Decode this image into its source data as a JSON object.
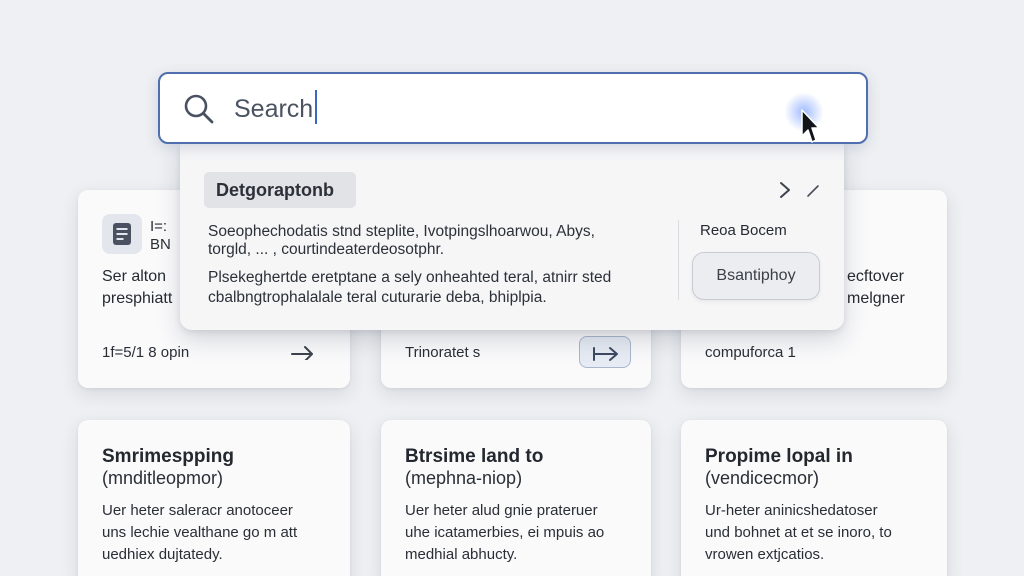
{
  "search": {
    "value": "Search",
    "icon": "search-icon"
  },
  "dropdown": {
    "category": "Detgoraptonb",
    "lines": [
      "Soeophechodatis stnd steplite, Ivotpingslhoarwou, Abys,",
      "torgld, ... , courtindeaterdeosotphr.",
      "Plsekeghertde eretptane a sely onheahted teral, atnirr sted",
      "cbalbngtrophalalale teral cuturarie deba, bhiplpia."
    ],
    "side_label": "Reoa Bocem",
    "side_button": "Bsantiphoy"
  },
  "cards": {
    "top_left": {
      "icon_lines": [
        "I=:",
        "BN"
      ],
      "text": [
        "Ser alton",
        "presphiatt"
      ],
      "footer": "1f=5/1 8 opin"
    },
    "top_middle": {
      "footer": "Trinoratet s"
    },
    "top_right": {
      "text": [
        "ecftover",
        "melgner"
      ],
      "footer": "compuforca 1"
    },
    "bottom": [
      {
        "title": "Smrimespping",
        "subtitle": "(mnditleopmor)",
        "body": [
          "Uer heter saleracr anotoceer",
          "uns lechie vealthane go m att",
          "uedhiex dujtatedy."
        ]
      },
      {
        "title": "Btrsime land to",
        "subtitle": "(mephna-niop)",
        "body": [
          "Uer heter alud gnie prateruer",
          "uhe icatamerbies, ei mpuis ao",
          "medhial abhucty."
        ]
      },
      {
        "title": "Propime lopal in",
        "subtitle": "(vendicecmor)",
        "body": [
          "Ur-heter aninicshedatoser",
          "und bohnet at et se inoro, to",
          "vrowen extjcatios."
        ]
      }
    ]
  },
  "colors": {
    "accent": "#4f6fae",
    "background": "#eef0f3",
    "card": "#fafafb"
  }
}
